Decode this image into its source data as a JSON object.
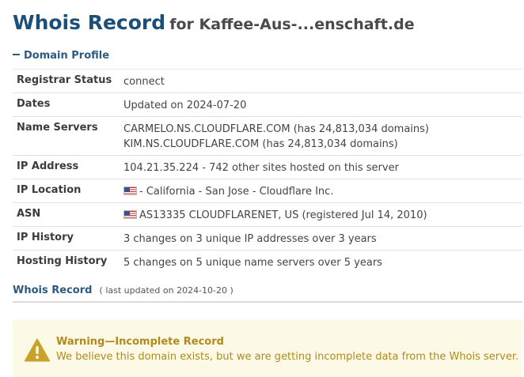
{
  "header": {
    "title": "Whois Record",
    "title_suffix": "for Kaffee-Aus-...enschaft.de"
  },
  "domain_profile": {
    "heading": "Domain Profile",
    "rows": [
      {
        "label": "Registrar Status",
        "value": "connect"
      },
      {
        "label": "Dates",
        "value": "Updated on 2024-07-20"
      },
      {
        "label": "Name Servers",
        "lines": [
          "CARMELO.NS.CLOUDFLARE.COM (has 24,813,034 domains)",
          "KIM.NS.CLOUDFLARE.COM (has 24,813,034 domains)"
        ]
      },
      {
        "label": "IP Address",
        "value": "104.21.35.224 - 742 other sites hosted on this server"
      },
      {
        "label": "IP Location",
        "value": "- California - San Jose - Cloudflare Inc.",
        "flag": "us-flag"
      },
      {
        "label": "ASN",
        "value": "AS13335 CLOUDFLARENET, US (registered Jul 14, 2010)",
        "flag": "us-flag"
      },
      {
        "label": "IP History",
        "value": "3 changes on 3 unique IP addresses over 3 years"
      },
      {
        "label": "Hosting History",
        "value": "5 changes on 5 unique name servers over 5 years"
      }
    ]
  },
  "whois_record": {
    "title": "Whois Record",
    "updated": "( last updated on 2024-10-20 )"
  },
  "warning": {
    "icon": "warning-icon",
    "title": "Warning—Incomplete Record",
    "message": "We believe this domain exists, but we are getting incomplete data from the Whois server."
  },
  "colors": {
    "heading_blue": "#1a4f7a",
    "link_blue": "#2c5a80",
    "warning_text": "#b08a1c",
    "warning_bg": "#fdf9e7",
    "warning_icon": "#c9a22c"
  }
}
